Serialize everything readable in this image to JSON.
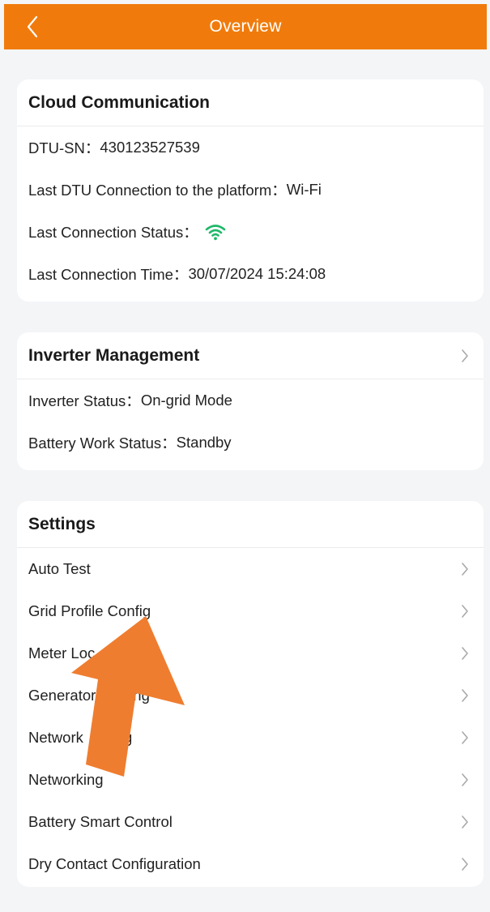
{
  "header": {
    "title": "Overview",
    "back_icon": "chevron-left-icon",
    "background": "#f07b0c"
  },
  "cloud": {
    "title": "Cloud Communication",
    "rows": [
      {
        "label": "DTU-SN：",
        "value": "430123527539"
      },
      {
        "label": "Last DTU Connection to the platform：",
        "value": "Wi-Fi"
      },
      {
        "label": "Last Connection Status：",
        "value": "",
        "icon": "wifi-icon",
        "icon_color": "#1fb86a"
      },
      {
        "label": "Last Connection Time：",
        "value": "30/07/2024 15:24:08"
      }
    ]
  },
  "inverter": {
    "title": "Inverter Management",
    "rows": [
      {
        "label": "Inverter Status：",
        "value": "On-grid Mode"
      },
      {
        "label": "Battery Work Status：",
        "value": "Standby"
      }
    ]
  },
  "settings": {
    "title": "Settings",
    "items": [
      "Auto Test",
      "Grid Profile Config",
      "Meter Loc",
      "Generator",
      "Network",
      "Networking",
      "Battery Smart Control",
      "Dry Contact Configuration"
    ],
    "items_tail": [
      "",
      "",
      "",
      "ng",
      "ig",
      "",
      "",
      ""
    ]
  },
  "overlay": {
    "icon": "orange-arrow-annotation",
    "color": "#ef7d2f"
  }
}
